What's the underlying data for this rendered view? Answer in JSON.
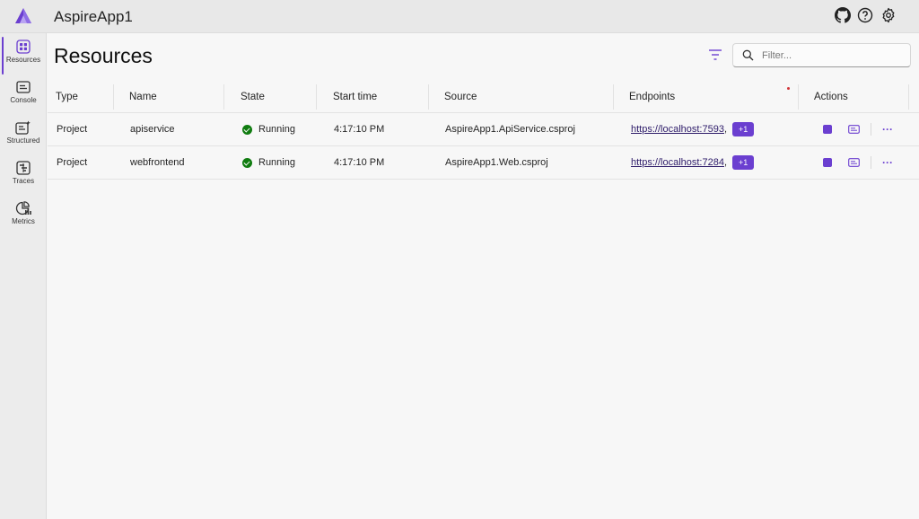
{
  "app": {
    "title": "AspireApp1"
  },
  "header_icons": [
    "github-icon",
    "help-icon",
    "settings-icon"
  ],
  "sidebar": {
    "items": [
      {
        "label": "Resources",
        "icon": "resources-icon",
        "active": true
      },
      {
        "label": "Console",
        "icon": "console-icon",
        "active": false
      },
      {
        "label": "Structured",
        "icon": "structured-icon",
        "active": false
      },
      {
        "label": "Traces",
        "icon": "traces-icon",
        "active": false
      },
      {
        "label": "Metrics",
        "icon": "metrics-icon",
        "active": false
      }
    ]
  },
  "main": {
    "title": "Resources",
    "search": {
      "placeholder": "Filter...",
      "value": ""
    }
  },
  "table": {
    "columns": [
      "Type",
      "Name",
      "State",
      "Start time",
      "Source",
      "Endpoints",
      "Actions"
    ],
    "rows": [
      {
        "type": "Project",
        "name": "apiservice",
        "state": "Running",
        "start_time": "4:17:10 PM",
        "source": "AspireApp1.ApiService.csproj",
        "endpoint": "https://localhost:7593",
        "endpoint_sep": ",",
        "extra_endpoints": "+1"
      },
      {
        "type": "Project",
        "name": "webfrontend",
        "state": "Running",
        "start_time": "4:17:10 PM",
        "source": "AspireApp1.Web.csproj",
        "endpoint": "https://localhost:7284",
        "endpoint_sep": ",",
        "extra_endpoints": "+1"
      }
    ]
  },
  "colors": {
    "accent": "#6b3fd0",
    "running": "#107c10",
    "link": "#2d1b69"
  }
}
